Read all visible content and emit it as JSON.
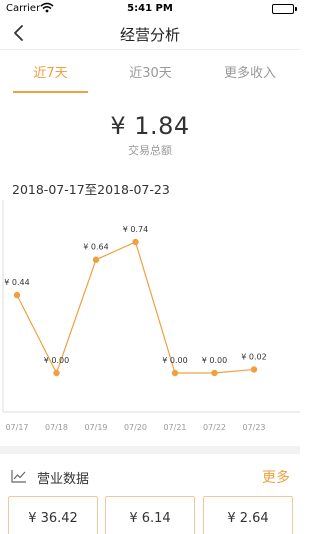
{
  "status_bar": {
    "carrier": "Carrier",
    "time": "5:41 PM"
  },
  "nav": {
    "title": "经营分析"
  },
  "tabs": [
    {
      "label": "近7天",
      "active": true
    },
    {
      "label": "近30天",
      "active": false
    },
    {
      "label": "更多收入",
      "active": false
    }
  ],
  "summary": {
    "amount": "¥ 1.84",
    "label": "交易总额"
  },
  "date_range": "2018-07-17至2018-07-23",
  "chart_data": {
    "type": "line",
    "categories": [
      "07/17",
      "07/18",
      "07/19",
      "07/20",
      "07/21",
      "07/22",
      "07/23"
    ],
    "values": [
      0.44,
      0.0,
      0.64,
      0.74,
      0.0,
      0.0,
      0.02
    ],
    "data_labels": [
      "¥ 0.44",
      "¥ 0.00",
      "¥ 0.64",
      "¥ 0.74",
      "¥ 0.00",
      "¥ 0.00",
      "¥ 0.02"
    ],
    "color": "#f0a040",
    "ylim": [
      0,
      0.74
    ],
    "grid": false
  },
  "section": {
    "heading": "营业数据",
    "more_label": "更多"
  },
  "cards": [
    {
      "value": "¥ 36.42"
    },
    {
      "value": "¥ 6.14"
    },
    {
      "value": "¥ 2.64"
    }
  ],
  "colors": {
    "accent": "#f0a040",
    "muted": "#999999",
    "divider": "#eeeeee"
  },
  "icons": [
    "wifi-icon",
    "battery-icon",
    "back-chevron-icon",
    "line-chart-icon"
  ]
}
